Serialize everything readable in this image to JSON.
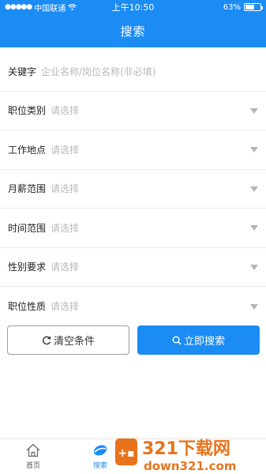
{
  "status_bar": {
    "carrier": "中国联通",
    "time": "上午10:50",
    "battery_percent": "63%",
    "battery_level": 0.63
  },
  "header": {
    "title": "搜索"
  },
  "form": {
    "keyword": {
      "label": "关键字",
      "placeholder": "企业名称/岗位名称(非必填)"
    },
    "fields": [
      {
        "label": "职位类别",
        "value": "请选择"
      },
      {
        "label": "工作地点",
        "value": "请选择"
      },
      {
        "label": "月薪范围",
        "value": "请选择"
      },
      {
        "label": "时间范围",
        "value": "请选择"
      },
      {
        "label": "性别要求",
        "value": "请选择"
      },
      {
        "label": "职位性质",
        "value": "请选择"
      }
    ]
  },
  "buttons": {
    "clear_label": "清空条件",
    "search_label": "立即搜索"
  },
  "tab_bar": {
    "items": [
      {
        "label": "首页",
        "icon": "home-icon"
      },
      {
        "label": "搜索",
        "icon": "search-tab-icon",
        "active": true
      }
    ]
  },
  "watermark": {
    "text": "321下载网",
    "url_text": "down321.com"
  },
  "colors": {
    "primary": "#1b8cf3",
    "watermark_orange": "#e8731b"
  }
}
